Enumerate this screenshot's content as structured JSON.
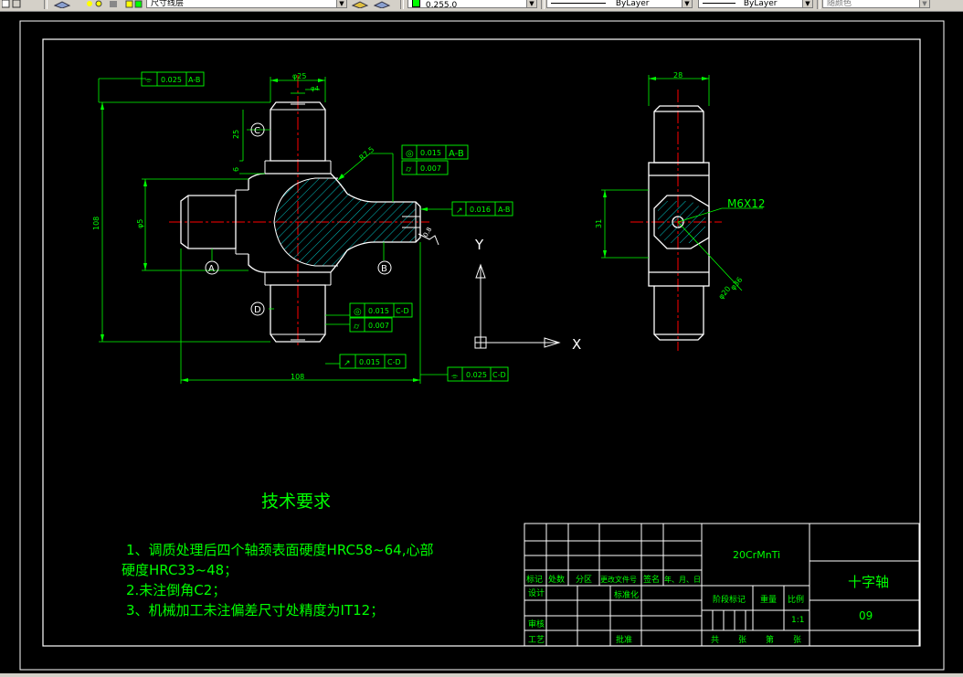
{
  "toolbar": {
    "layer_name": "尺寸线层",
    "color_value": "0,255,0",
    "linetype": "ByLayer",
    "lineweight": "ByLayer",
    "plotstyle": "随颜色"
  },
  "front_view": {
    "dim_top_width": "φ25",
    "dim_top_small": "φ4",
    "dim_vert_25": "25",
    "dim_vert_6": "6",
    "dim_total_height": "108",
    "dim_left_dia": "φ5",
    "dim_total_width": "108",
    "dim_radius": "R7.5",
    "label_A": "A",
    "label_B": "B",
    "label_C": "C",
    "label_D": "D",
    "roughness": "0.8",
    "tol_sym_top": {
      "value": "0.025",
      "datum": "A-B"
    },
    "tol_coax_top": {
      "value": "0.015",
      "datum": "A-B"
    },
    "tol_cyl_top": {
      "value": "0.007"
    },
    "tol_runout_right": {
      "value": "0.016",
      "datum": "A-B"
    },
    "tol_coax_bottom": {
      "value": "0.015",
      "datum": "C-D"
    },
    "tol_cyl_bottom": {
      "value": "0.007"
    },
    "tol_runout_bottom": {
      "value": "0.015",
      "datum": "C-D"
    },
    "tol_sym_bottom": {
      "value": "0.025",
      "datum": "C-D"
    }
  },
  "side_view": {
    "dim_top": "28",
    "dim_left": "31",
    "thread_label": "M6X12",
    "dim_diag_1": "φ20",
    "dim_diag_2": "φ36"
  },
  "ucs": {
    "x_label": "X",
    "y_label": "Y"
  },
  "tech_requirements": {
    "title": "技术要求",
    "line1": "1、调质处理后四个轴颈表面硬度HRC58~64,心部",
    "line2": "硬度HRC33~48；",
    "line3": "2.未注倒角C2；",
    "line4": "3、机械加工未注偏差尺寸处精度为IT12；"
  },
  "title_block": {
    "material": "20CrMnTi",
    "part_name": "十字轴",
    "drawing_no": "09",
    "scale_value": "1:1",
    "h_biaoji": "标记",
    "h_chushu": "处数",
    "h_fenqu": "分区",
    "h_gaiwen": "更改文件号",
    "h_qianming": "签名",
    "h_date": "年、月、日",
    "h_sheji": "设计",
    "h_biaozhunhua": "标准化",
    "h_jieduan": "阶段标记",
    "h_zhongliang": "重量",
    "h_bili": "比例",
    "h_shenhe": "审核",
    "h_gongyi": "工艺",
    "h_pizhun": "批准",
    "h_gong": "共",
    "h_zhang1": "张",
    "h_di": "第",
    "h_zhang2": "张"
  }
}
